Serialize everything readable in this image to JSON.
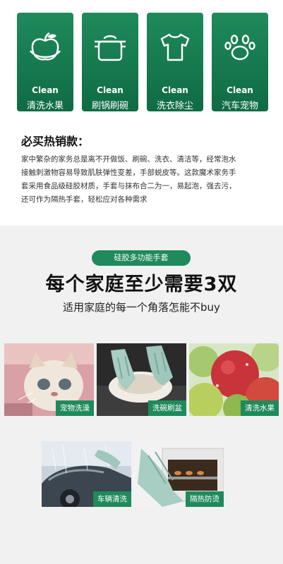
{
  "cards": [
    {
      "en": "Clean",
      "zh": "清洗水果",
      "icon": "apple-icon"
    },
    {
      "en": "Clean",
      "zh": "刷锅刷碗",
      "icon": "pot-icon"
    },
    {
      "en": "Clean",
      "zh": "洗衣除尘",
      "icon": "tshirt-icon"
    },
    {
      "en": "Clean",
      "zh": "汽车宠物",
      "icon": "paw-icon"
    }
  ],
  "hot_sale": {
    "title": "必买热销款：",
    "desc_lines": [
      "家中繁杂的家务总是离不开做饭、刷碗、洗衣、清洁等，经常泡水",
      "接触刺激物容易导致肌肤弹性变差，手部蜕皮等。这款魔术家务手",
      "套采用食品级硅胶材质，手套与抹布合二为一，易起泡，强去污，",
      "还可作为隔热手套，轻松应对各种需求"
    ]
  },
  "feature": {
    "pill": "硅胶多功能手套",
    "headline": "每个家庭至少需要3双",
    "subline": "适用家庭的每一个角落怎能不buy"
  },
  "tiles": [
    {
      "label": "宠物洗澡"
    },
    {
      "label": "洗碗刷盆"
    },
    {
      "label": "清洗水果"
    },
    {
      "label": "车辆清洗"
    },
    {
      "label": "隔热防烫"
    }
  ],
  "colors": {
    "brand_green": "#1f8a5b",
    "grey_bg": "#f1f1f1"
  }
}
